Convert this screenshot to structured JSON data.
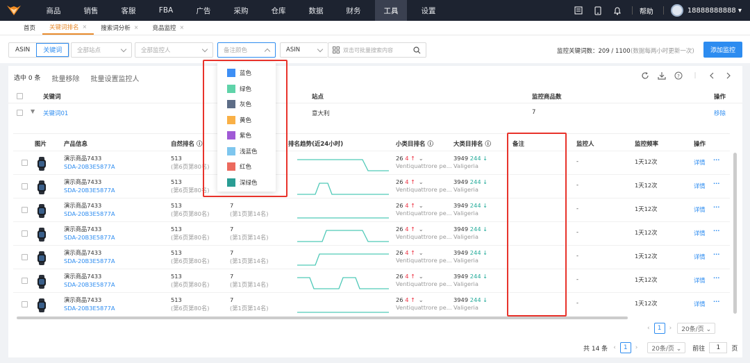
{
  "nav": {
    "items": [
      "商品",
      "销售",
      "客服",
      "FBA",
      "广告",
      "采购",
      "仓库",
      "数据",
      "财务",
      "工具",
      "设置"
    ],
    "active_index": 9,
    "help": "帮助",
    "user_phone": "18888888888 ▾"
  },
  "tabs": [
    {
      "label": "首页",
      "closable": false,
      "active": false
    },
    {
      "label": "关键词排名",
      "closable": true,
      "active": true
    },
    {
      "label": "搜索词分析",
      "closable": true,
      "active": false
    },
    {
      "label": "竞品监控",
      "closable": true,
      "active": false
    }
  ],
  "filters": {
    "seg_asin": "ASIN",
    "seg_keyword": "关键词",
    "site_placeholder": "全部站点",
    "monitor_placeholder": "全部监控人",
    "color_placeholder": "备注颜色",
    "asin_select": "ASIN",
    "search_placeholder": "双击可批量搜索内容",
    "monitor_count": "监控关键词数：209 / 1100",
    "monitor_note": "(数据每两小时更新一次)",
    "add_button": "添加监控"
  },
  "actions": {
    "selected": "选中 0 条",
    "batch_remove": "批量移除",
    "batch_set_monitor": "批量设置监控人"
  },
  "outer_table": {
    "headers": {
      "keyword": "关键词",
      "site": "站点",
      "count": "监控商品数",
      "op": "操作"
    },
    "row": {
      "keyword": "关键词01",
      "site": "意大利",
      "count": "7",
      "op": "移除"
    }
  },
  "inner_table": {
    "headers": {
      "img": "图片",
      "product": "产品信息",
      "natural": "自然排名 ⓘ",
      "trend": "排名趋势(近24小时)",
      "sub_rank": "小类目排名 ⓘ",
      "big_rank": "大类目排名 ⓘ",
      "note": "备注",
      "monitor": "监控人",
      "freq": "监控频率",
      "op": "操作"
    },
    "rows": [
      {
        "name": "演示商品7433",
        "sku": "SDA-20B3E5877A",
        "rank": "513",
        "rank_sub": "(第6页第80名)",
        "rank2": "7",
        "rank2_sub": "(第1页第14名)",
        "sub": "26",
        "sub_d": "4 ↑",
        "sub_cat": "Ventiquattrore pe...",
        "big": "3949",
        "big_d": "244 ↓",
        "big_cat": "Valigeria",
        "monitor": "-",
        "freq": "1天12次",
        "detail": "详情",
        "more": "···"
      },
      {
        "name": "演示商品7433",
        "sku": "SDA-20B3E5877A",
        "rank": "513",
        "rank_sub": "(第6页第80名)",
        "rank2": "7",
        "rank2_sub": "(第1页第14名)",
        "sub": "26",
        "sub_d": "4 ↑",
        "sub_cat": "Ventiquattrore pe...",
        "big": "3949",
        "big_d": "244 ↓",
        "big_cat": "Valigeria",
        "monitor": "-",
        "freq": "1天12次",
        "detail": "详情",
        "more": "···"
      },
      {
        "name": "演示商品7433",
        "sku": "SDA-20B3E5877A",
        "rank": "513",
        "rank_sub": "(第6页第80名)",
        "rank2": "7",
        "rank2_sub": "(第1页第14名)",
        "sub": "26",
        "sub_d": "4 ↑",
        "sub_cat": "Ventiquattrore pe...",
        "big": "3949",
        "big_d": "244 ↓",
        "big_cat": "Valigeria",
        "monitor": "-",
        "freq": "1天12次",
        "detail": "详情",
        "more": "···"
      },
      {
        "name": "演示商品7433",
        "sku": "SDA-20B3E5877A",
        "rank": "513",
        "rank_sub": "(第6页第80名)",
        "rank2": "7",
        "rank2_sub": "(第1页第14名)",
        "sub": "26",
        "sub_d": "4 ↑",
        "sub_cat": "Ventiquattrore pe...",
        "big": "3949",
        "big_d": "244 ↓",
        "big_cat": "Valigeria",
        "monitor": "-",
        "freq": "1天12次",
        "detail": "详情",
        "more": "···"
      },
      {
        "name": "演示商品7433",
        "sku": "SDA-20B3E5877A",
        "rank": "513",
        "rank_sub": "(第6页第80名)",
        "rank2": "7",
        "rank2_sub": "(第1页第14名)",
        "sub": "26",
        "sub_d": "4 ↑",
        "sub_cat": "Ventiquattrore pe...",
        "big": "3949",
        "big_d": "244 ↓",
        "big_cat": "Valigeria",
        "monitor": "-",
        "freq": "1天12次",
        "detail": "详情",
        "more": "···"
      },
      {
        "name": "演示商品7433",
        "sku": "SDA-20B3E5877A",
        "rank": "513",
        "rank_sub": "(第6页第80名)",
        "rank2": "7",
        "rank2_sub": "(第1页第14名)",
        "sub": "26",
        "sub_d": "4 ↑",
        "sub_cat": "Ventiquattrore pe...",
        "big": "3949",
        "big_d": "244 ↓",
        "big_cat": "Valigeria",
        "monitor": "-",
        "freq": "1天12次",
        "detail": "详情",
        "more": "···"
      },
      {
        "name": "演示商品7433",
        "sku": "SDA-20B3E5877A",
        "rank": "513",
        "rank_sub": "(第6页第80名)",
        "rank2": "7",
        "rank2_sub": "(第1页第14名)",
        "sub": "26",
        "sub_d": "4 ↑",
        "sub_cat": "Ventiquattrore pe...",
        "big": "3949",
        "big_d": "244 ↓",
        "big_cat": "Valigeria",
        "monitor": "-",
        "freq": "1天12次",
        "detail": "详情",
        "more": "···"
      }
    ]
  },
  "inner_pager": {
    "page": "1",
    "size": "20条/页 ⌄"
  },
  "outer_pager": {
    "total": "共 14 条",
    "page": "1",
    "size": "20条/页 ⌄",
    "goto": "前往",
    "goto_value": "1",
    "page_unit": "页"
  },
  "color_options": [
    {
      "label": "蓝色",
      "color": "#3d8ff5"
    },
    {
      "label": "绿色",
      "color": "#5fd3a9"
    },
    {
      "label": "灰色",
      "color": "#5d6d87"
    },
    {
      "label": "黄色",
      "color": "#f9b046"
    },
    {
      "label": "紫色",
      "color": "#a05ad6"
    },
    {
      "label": "浅蓝色",
      "color": "#7ec6ee"
    },
    {
      "label": "红色",
      "color": "#ec6a5e"
    },
    {
      "label": "深绿色",
      "color": "#2a9d94"
    }
  ],
  "colors": {
    "accent": "#2d8cf0",
    "tab_active": "#e88a2c",
    "highlight": "#e8322a",
    "nav_bg": "#1d2330"
  }
}
